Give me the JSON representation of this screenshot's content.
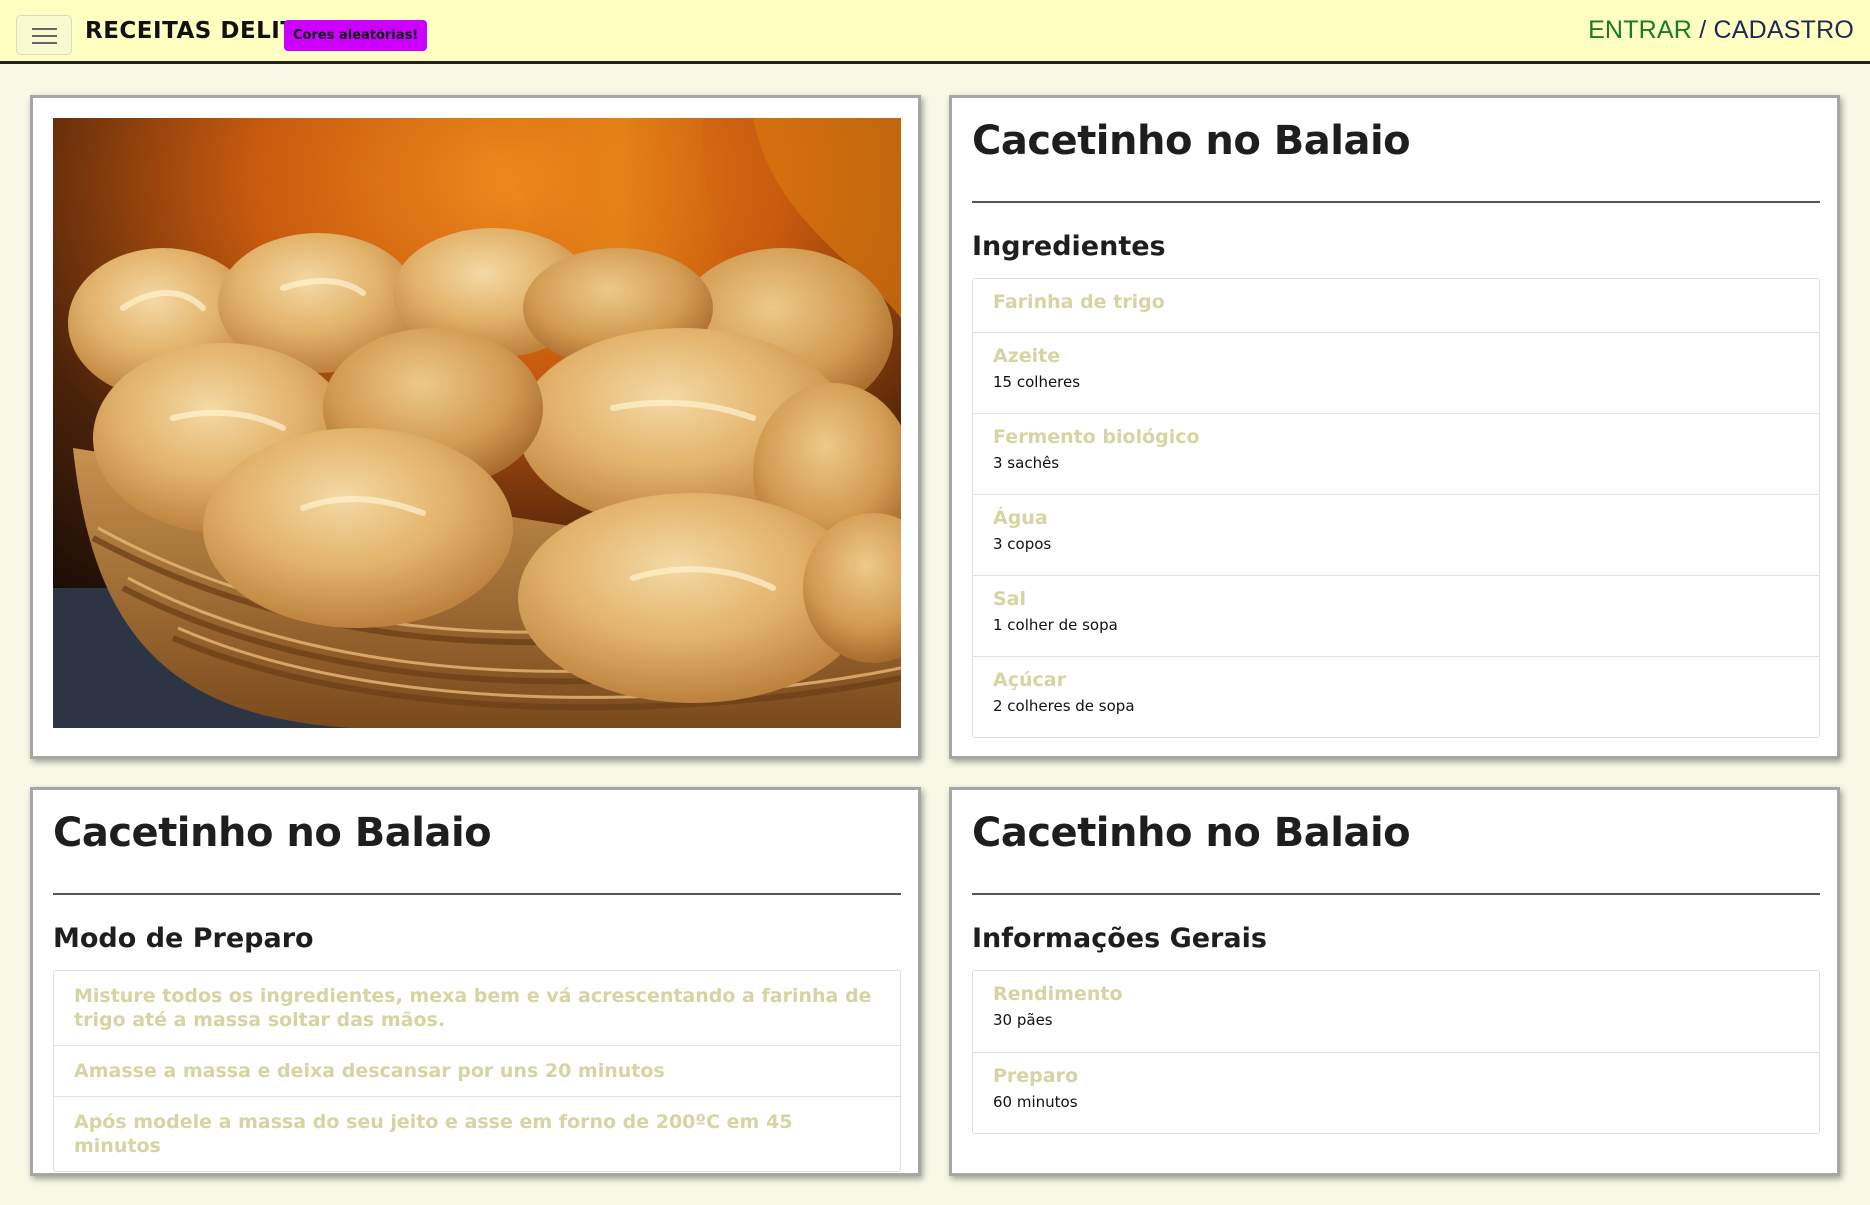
{
  "navbar": {
    "brand": "RECEITAS DELIT",
    "badge": "Cores aleatórias!",
    "login": "ENTRAR",
    "separator": " / ",
    "register": "CADASTRO",
    "menu_icon": "hamburger-menu-icon",
    "colors": {
      "background": "#ffffc2",
      "badge": "#cc00ff",
      "login": "#1a7a2a",
      "register": "#1b2a5a"
    }
  },
  "recipe": {
    "title": "Cacetinho no Balaio",
    "photo_alt": "Pães franceses em um balaio"
  },
  "ingredients": {
    "title": "Cacetinho no Balaio",
    "heading": "Ingredientes",
    "items": [
      {
        "name": "Farinha de trigo",
        "qty": ""
      },
      {
        "name": "Azeite",
        "qty": "15 colheres"
      },
      {
        "name": "Fermento biológico",
        "qty": "3 sachês"
      },
      {
        "name": "Água",
        "qty": "3 copos"
      },
      {
        "name": "Sal",
        "qty": "1 colher de sopa"
      },
      {
        "name": "Açúcar",
        "qty": "2 colheres de sopa"
      }
    ]
  },
  "steps": {
    "title": "Cacetinho no Balaio",
    "heading": "Modo de Preparo",
    "items": [
      "Misture todos os ingredientes, mexa bem e vá acrescentando a farinha de trigo até a massa soltar das mãos.",
      "Amasse a massa e deixa descansar por uns 20 minutos",
      "Após modele a massa do seu jeito e asse em forno de 200ºC em 45 minutos"
    ]
  },
  "info": {
    "title": "Cacetinho no Balaio",
    "heading": "Informações Gerais",
    "items": [
      {
        "name": "Rendimento",
        "value": "30 pães"
      },
      {
        "name": "Preparo",
        "value": "60 minutos"
      }
    ]
  },
  "colors": {
    "page_background": "#f8f8e6",
    "item_name": "#d6d4a2"
  }
}
